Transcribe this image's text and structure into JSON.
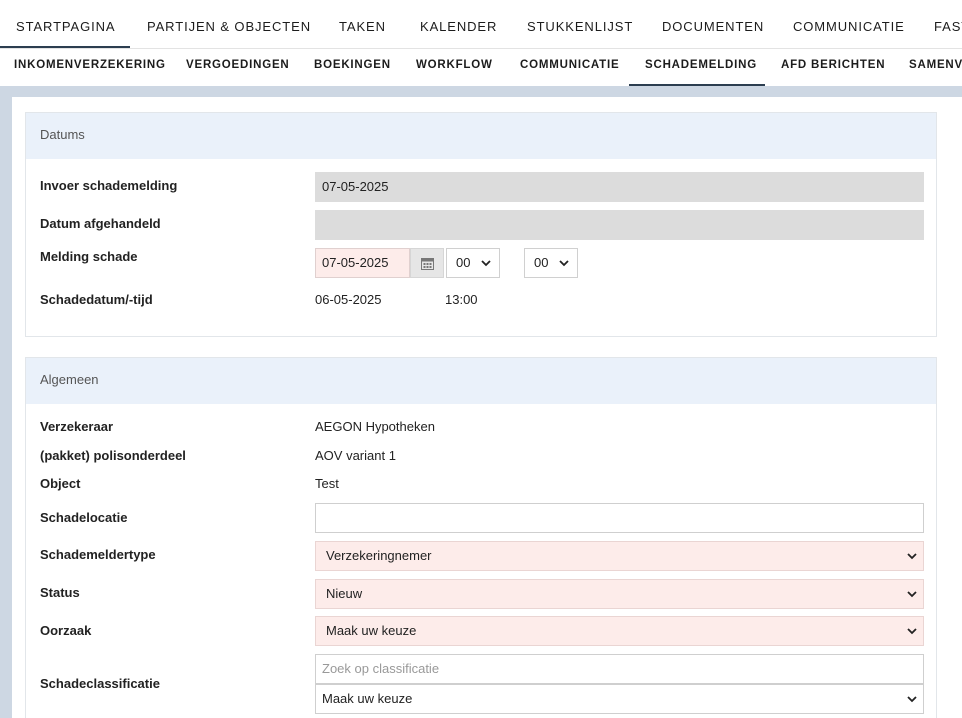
{
  "topnav": [
    {
      "label": "STARTPAGINA"
    },
    {
      "label": "PARTIJEN & OBJECTEN"
    },
    {
      "label": "TAKEN"
    },
    {
      "label": "KALENDER"
    },
    {
      "label": "STUKKENLIJST"
    },
    {
      "label": "DOCUMENTEN"
    },
    {
      "label": "COMMUNICATIE"
    },
    {
      "label": "FAST"
    }
  ],
  "subnav": [
    {
      "label": "INKOMENVERZEKERING"
    },
    {
      "label": "VERGOEDINGEN"
    },
    {
      "label": "BOEKINGEN"
    },
    {
      "label": "WORKFLOW"
    },
    {
      "label": "COMMUNICATIE"
    },
    {
      "label": "SCHADEMELDING"
    },
    {
      "label": "AFD BERICHTEN"
    },
    {
      "label": "SAMENVA"
    }
  ],
  "datums": {
    "title": "Datums",
    "invoer_label": "Invoer schademelding",
    "invoer_value": "07-05-2025",
    "afgehandeld_label": "Datum afgehandeld",
    "afgehandeld_value": "",
    "melding_label": "Melding schade",
    "melding_date": "07-05-2025",
    "melding_hour": "00",
    "melding_minute": "00",
    "schadedatum_label": "Schadedatum/-tijd",
    "schadedatum_date": "06-05-2025",
    "schadedatum_time": "13:00"
  },
  "algemeen": {
    "title": "Algemeen",
    "verzekeraar_label": "Verzekeraar",
    "verzekeraar_value": "AEGON Hypotheken",
    "polis_label": "(pakket) polisonderdeel",
    "polis_value": "AOV variant 1",
    "object_label": "Object",
    "object_value": "Test",
    "schadelocatie_label": "Schadelocatie",
    "schadelocatie_value": "",
    "meldertype_label": "Schademeldertype",
    "meldertype_value": "Verzekeringnemer",
    "status_label": "Status",
    "status_value": "Nieuw",
    "oorzaak_label": "Oorzaak",
    "oorzaak_value": "Maak uw keuze",
    "classificatie_label": "Schadeclassificatie",
    "classificatie_search_placeholder": "Zoek op classificatie",
    "classificatie_value": "Maak uw keuze"
  },
  "icons": {
    "calendar": "calendar-icon",
    "dropdown": "chevron-down-icon"
  },
  "colors": {
    "required_field_bg": "#fdecea",
    "readonly_field_bg": "#dcdcdc",
    "section_header_bg": "#eaf1fa",
    "active_tab_underline": "#2c3e50",
    "page_background": "#cdd7e3"
  }
}
